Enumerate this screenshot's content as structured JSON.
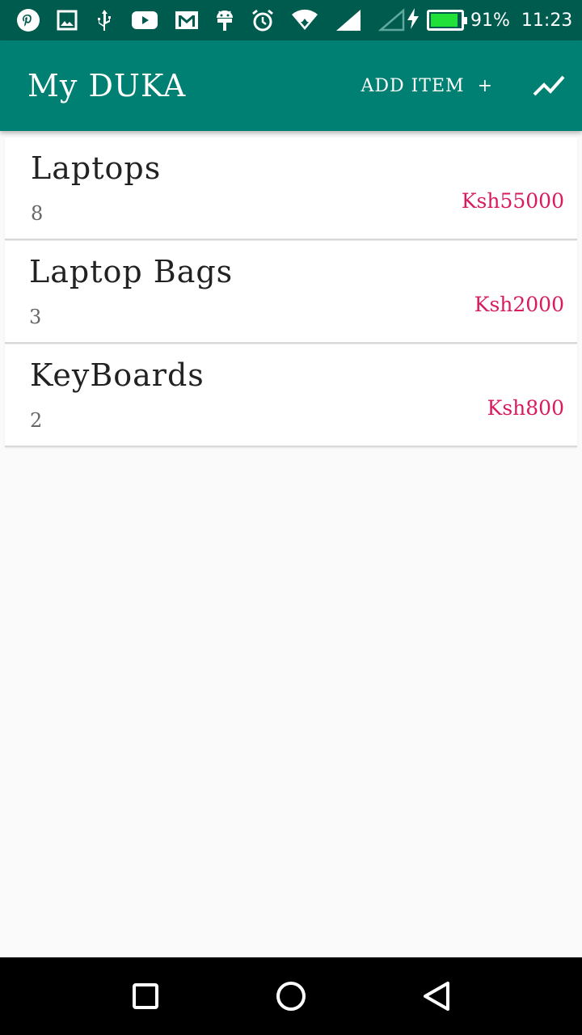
{
  "status_bar": {
    "icons": [
      "pinterest-icon",
      "image-icon",
      "usb-icon",
      "youtube-icon",
      "gmail-icon",
      "android-icon",
      "alarm-icon",
      "wifi-icon",
      "cell-signal-icon",
      "cell-signal-empty-icon",
      "charging-icon",
      "battery-icon"
    ],
    "battery_percent": "91%",
    "battery_level": 0.91,
    "time": "11:23"
  },
  "app_bar": {
    "title": "My DUKA",
    "add_item_label": "ADD ITEM",
    "add_item_plus": "+",
    "trend_icon": "trending-up-icon"
  },
  "items": [
    {
      "name": "Laptops",
      "qty": "8",
      "price": "Ksh55000"
    },
    {
      "name": "Laptop Bags",
      "qty": "3",
      "price": "Ksh2000"
    },
    {
      "name": "KeyBoards",
      "qty": "2",
      "price": "Ksh800"
    }
  ],
  "nav_bar": {
    "icons": [
      "recents-square-icon",
      "home-circle-icon",
      "back-triangle-icon"
    ]
  },
  "colors": {
    "status_bar": "#005b4f",
    "app_bar": "#008073",
    "price": "#d81b60",
    "background": "#fafafa"
  }
}
